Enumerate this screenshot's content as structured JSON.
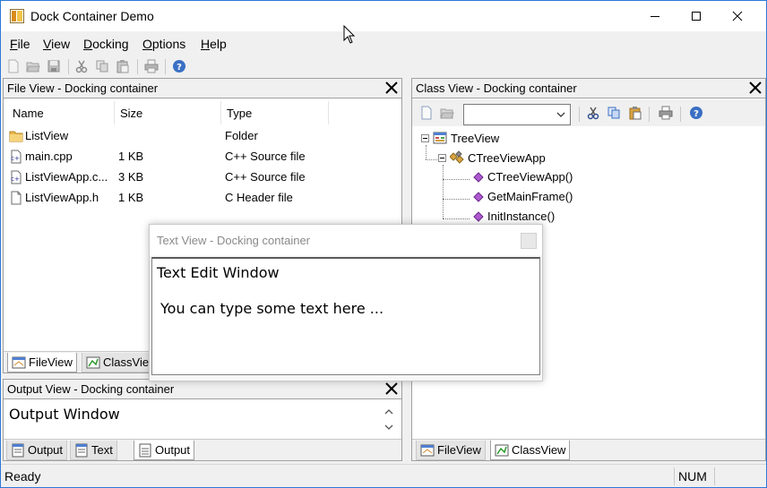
{
  "window": {
    "title": "Dock Container Demo"
  },
  "menu": {
    "items": [
      {
        "pre": "",
        "u": "F",
        "post": "ile"
      },
      {
        "pre": "",
        "u": "V",
        "post": "iew"
      },
      {
        "pre": "",
        "u": "D",
        "post": "ocking"
      },
      {
        "pre": "",
        "u": "O",
        "post": "ptions"
      },
      {
        "pre": "",
        "u": "H",
        "post": "elp"
      }
    ]
  },
  "file_view": {
    "caption": "File View - Docking container",
    "columns": [
      "Name",
      "Size",
      "Type"
    ],
    "rows": [
      {
        "name": "ListView",
        "size": "",
        "type": "Folder",
        "icon": "folder-icon"
      },
      {
        "name": "main.cpp",
        "size": "1 KB",
        "type": "C++ Source file",
        "icon": "cpp-file-icon"
      },
      {
        "name": "ListViewApp.c...",
        "size": "3 KB",
        "type": "C++ Source file",
        "icon": "cpp-file-icon"
      },
      {
        "name": "ListViewApp.h",
        "size": "1 KB",
        "type": "C Header file",
        "icon": "header-file-icon"
      }
    ],
    "tabs": [
      "FileView",
      "ClassView"
    ]
  },
  "class_view": {
    "caption": "Class View - Docking container",
    "combo_value": "",
    "tree": {
      "root": "TreeView",
      "class": "CTreeViewApp",
      "methods": [
        "CTreeViewApp()",
        "GetMainFrame()",
        "InitInstance()"
      ]
    },
    "tabs": [
      "FileView",
      "ClassView"
    ]
  },
  "text_view": {
    "caption": "Text View - Docking container",
    "heading": "Text Edit Window",
    "body": "You can type some text here ..."
  },
  "output_view": {
    "caption": "Output View - Docking container",
    "text": "Output Window",
    "tabs": [
      "Output",
      "Text",
      "Output"
    ]
  },
  "status": {
    "text": "Ready",
    "num": "NUM"
  }
}
